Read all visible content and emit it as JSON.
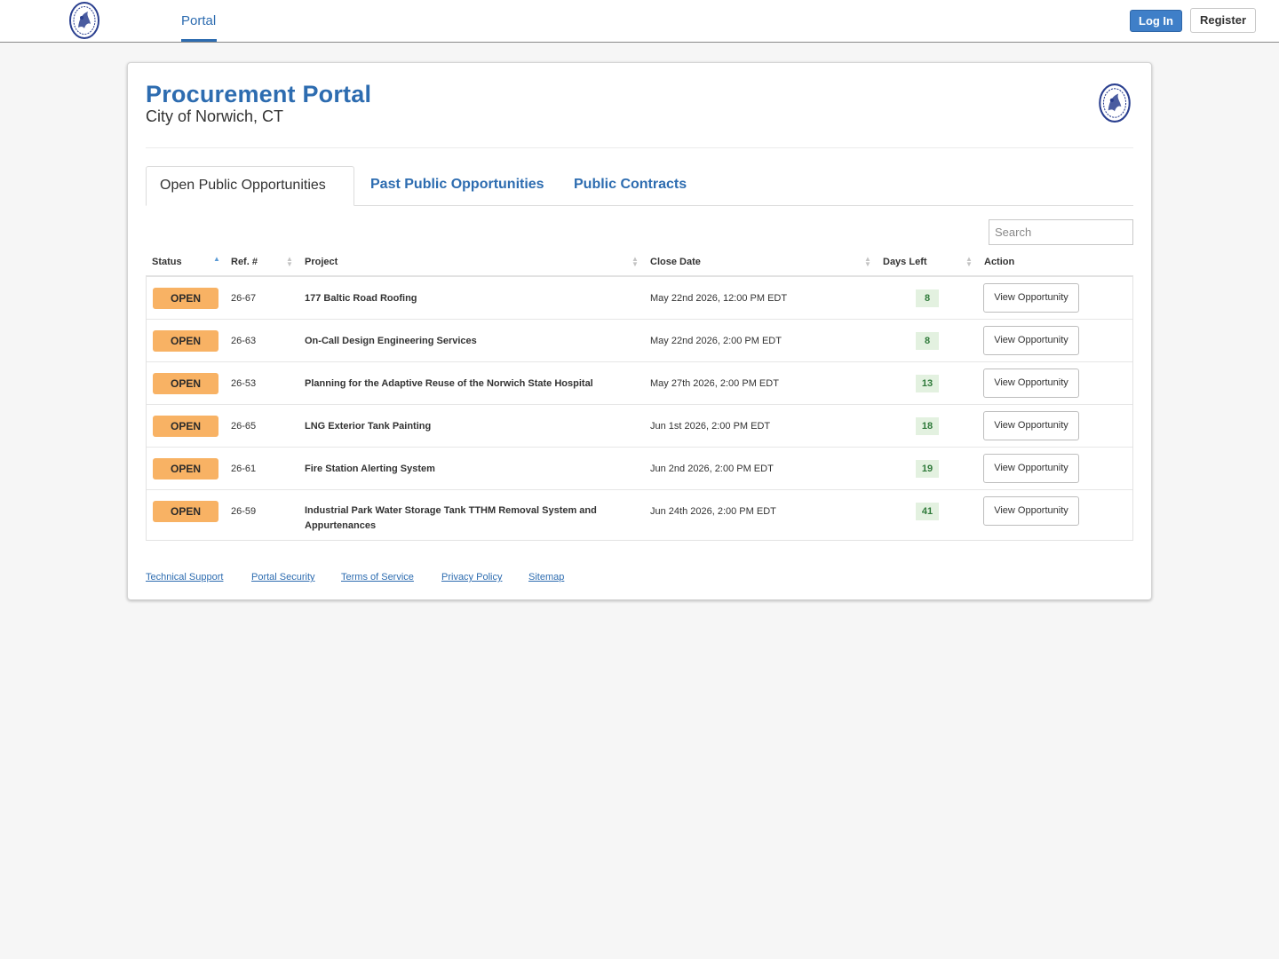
{
  "nav": {
    "portal_tab": "Portal",
    "login_label": "Log In",
    "register_label": "Register"
  },
  "header": {
    "title": "Procurement Portal",
    "subtitle": "City of Norwich, CT"
  },
  "tabs": [
    {
      "label": "Open Public Opportunities"
    },
    {
      "label": "Past Public Opportunities"
    },
    {
      "label": "Public Contracts"
    }
  ],
  "search": {
    "placeholder": "Search"
  },
  "table": {
    "columns": [
      "Status",
      "Ref. #",
      "Project",
      "Close Date",
      "Days Left",
      "Action"
    ],
    "rows": [
      {
        "status": "OPEN",
        "ref": "26-67",
        "project": "177 Baltic Road Roofing",
        "close": "May 22nd 2026, 12:00 PM EDT",
        "days": "8",
        "action": "View Opportunity"
      },
      {
        "status": "OPEN",
        "ref": "26-63",
        "project": "On-Call Design Engineering Services",
        "close": "May 22nd 2026, 2:00 PM EDT",
        "days": "8",
        "action": "View Opportunity"
      },
      {
        "status": "OPEN",
        "ref": "26-53",
        "project": "Planning for the Adaptive Reuse of the Norwich State Hospital",
        "close": "May 27th 2026, 2:00 PM EDT",
        "days": "13",
        "action": "View Opportunity"
      },
      {
        "status": "OPEN",
        "ref": "26-65",
        "project": "LNG Exterior Tank Painting",
        "close": "Jun 1st 2026, 2:00 PM EDT",
        "days": "18",
        "action": "View Opportunity"
      },
      {
        "status": "OPEN",
        "ref": "26-61",
        "project": "Fire Station Alerting System",
        "close": "Jun 2nd 2026, 2:00 PM EDT",
        "days": "19",
        "action": "View Opportunity"
      },
      {
        "status": "OPEN",
        "ref": "26-59",
        "project": "Industrial Park Water Storage Tank TTHM Removal System and Appurtenances",
        "close": "Jun 24th 2026, 2:00 PM EDT",
        "days": "41",
        "action": "View Opportunity"
      }
    ]
  },
  "footer": {
    "links": [
      "Technical Support",
      "Portal Security",
      "Terms of Service",
      "Privacy Policy",
      "Sitemap"
    ]
  },
  "colors": {
    "brand_blue": "#2d6cb0",
    "open_badge": "#f8b264",
    "days_badge_bg": "#e3f1e0",
    "days_badge_text": "#2f7a3a"
  }
}
